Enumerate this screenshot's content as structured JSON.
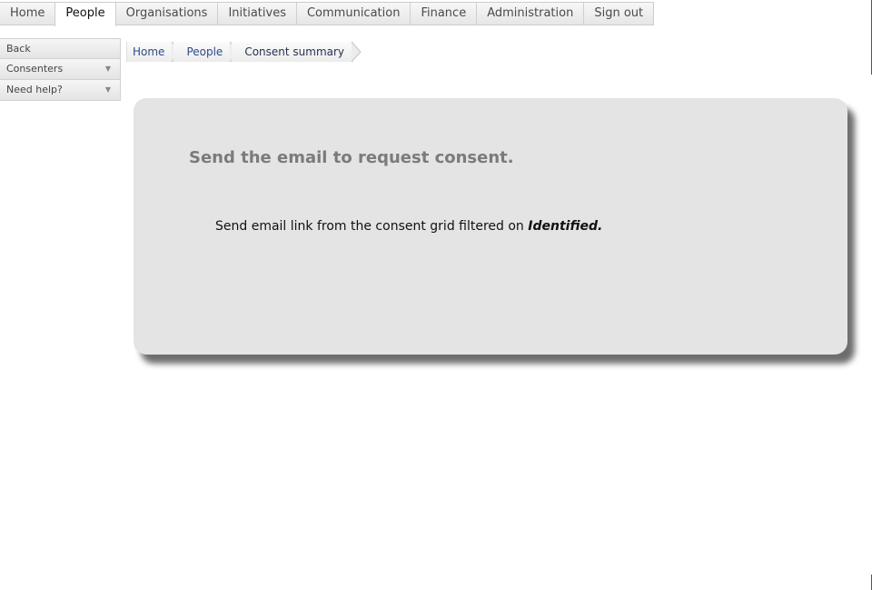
{
  "topnav": {
    "tabs": [
      {
        "label": "Home"
      },
      {
        "label": "People",
        "active": true
      },
      {
        "label": "Organisations"
      },
      {
        "label": "Initiatives"
      },
      {
        "label": "Communication"
      },
      {
        "label": "Finance"
      },
      {
        "label": "Administration"
      },
      {
        "label": "Sign out"
      }
    ]
  },
  "sidebar": {
    "back_label": "Back",
    "consenters_label": "Consenters",
    "need_help_label": "Need help?"
  },
  "breadcrumb": {
    "items": [
      "Home",
      "People",
      "Consent summary"
    ]
  },
  "panel": {
    "title": "Send the email to request consent.",
    "message_prefix": "Send email link from the consent grid filtered on",
    "message_filter": "Identified."
  },
  "colors": {
    "panel_bg": "#e4e4e4",
    "title_color": "#7b7b7b",
    "link_color": "#2e4a8a"
  },
  "icons": {
    "dropdown": "chevron-down-icon",
    "breadcrumb_separator": "chevron-right-icon"
  }
}
